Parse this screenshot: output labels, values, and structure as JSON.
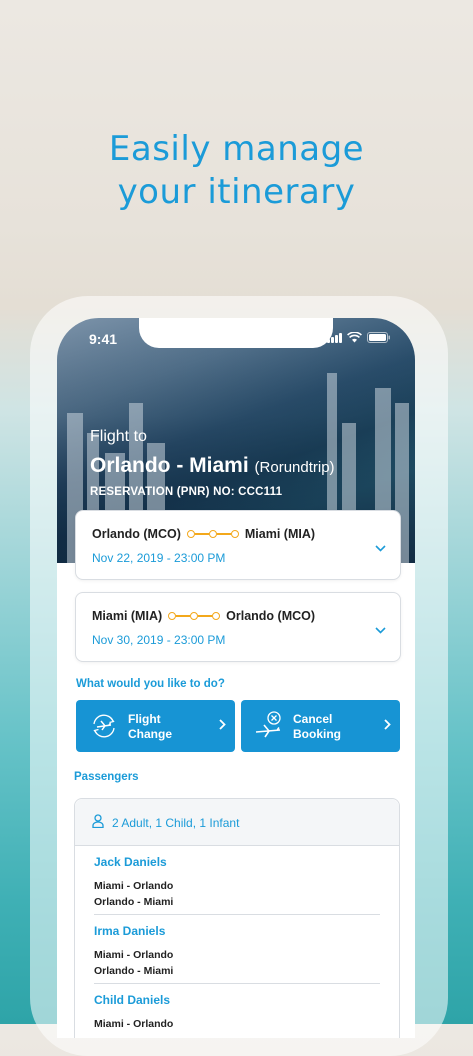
{
  "headline": {
    "line1": "Easily manage",
    "line2": "your itinerary"
  },
  "status_bar": {
    "time": "9:41"
  },
  "hero": {
    "label": "Flight to",
    "route": "Orlando - Miami",
    "trip_type": "(Rorundtrip)",
    "reservation": "RESERVATION (PNR) NO: CCC111"
  },
  "flights": [
    {
      "from": "Orlando (MCO)",
      "to": "Miami (MIA)",
      "date": "Nov 22, 2019 - 23:00 PM"
    },
    {
      "from": "Miami (MIA)",
      "to": "Orlando (MCO)",
      "date": "Nov 30, 2019 - 23:00 PM"
    }
  ],
  "actions": {
    "question": "What would you like to do?",
    "flight_change": {
      "line1": "Flight",
      "line2": "Change"
    },
    "cancel_booking": {
      "line1": "Cancel",
      "line2": "Booking"
    }
  },
  "passengers": {
    "title": "Passengers",
    "summary": "2 Adult, 1 Child, 1 Infant",
    "list": [
      {
        "name": "Jack Daniels",
        "seg1": "Miami - Orlando",
        "seg2": "Orlando - Miami"
      },
      {
        "name": "Irma Daniels",
        "seg1": "Miami - Orlando",
        "seg2": "Orlando - Miami"
      },
      {
        "name": "Child Daniels",
        "seg1": "Miami - Orlando",
        "seg2": ""
      }
    ]
  },
  "colors": {
    "accent": "#1b9bd8",
    "button": "#1794d4",
    "route_dots": "#f3a81b"
  }
}
